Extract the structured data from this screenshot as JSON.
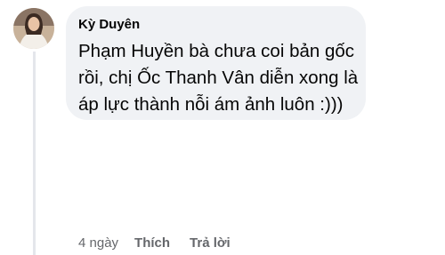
{
  "comment": {
    "author": "Kỳ Duyên",
    "text": "Phạm Huyền bà chưa coi bản gốc rồi, chị Ốc Thanh Vân diễn xong là áp lực thành nỗi ám ảnh luôn :)))",
    "timestamp": "4 ngày",
    "like_label": "Thích",
    "reply_label": "Trả lời"
  },
  "colors": {
    "bubble_bg": "#f0f2f5",
    "text": "#050505",
    "secondary_text": "#65676b",
    "thread_line": "#e4e6eb"
  }
}
